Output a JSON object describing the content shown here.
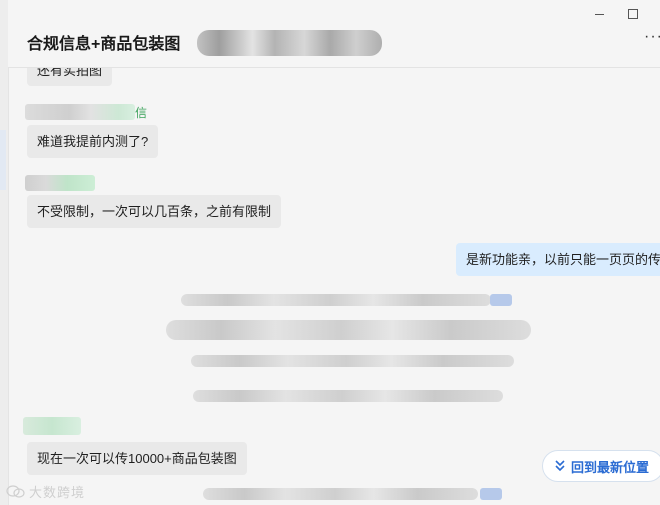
{
  "window": {
    "minimize_glyph": "minimize-icon",
    "maximize_glyph": "maximize-icon",
    "more_glyph": "···"
  },
  "header": {
    "title": "合规信息+商品包装图"
  },
  "messages": {
    "m0_text": "还有实拍图",
    "m1_sender_suffix": "信",
    "m1_text": "难道我提前内测了?",
    "m2_text": "不受限制，一次可以几百条，之前有限制",
    "m3_text": "是新功能亲，以前只能一页页的传",
    "m4_text": "现在一次可以传10000+商品包装图"
  },
  "scroll": {
    "label": "回到最新位置",
    "icon": "double-chevron-down-icon"
  },
  "watermark": {
    "text": "大数跨境",
    "icon": "wechat-icon"
  },
  "colors": {
    "incoming_bubble": "#e9e9e9",
    "outgoing_bubble": "#d9ecfe",
    "accent_blue": "#2b6cd3",
    "sender_green": "#3aa35a"
  }
}
